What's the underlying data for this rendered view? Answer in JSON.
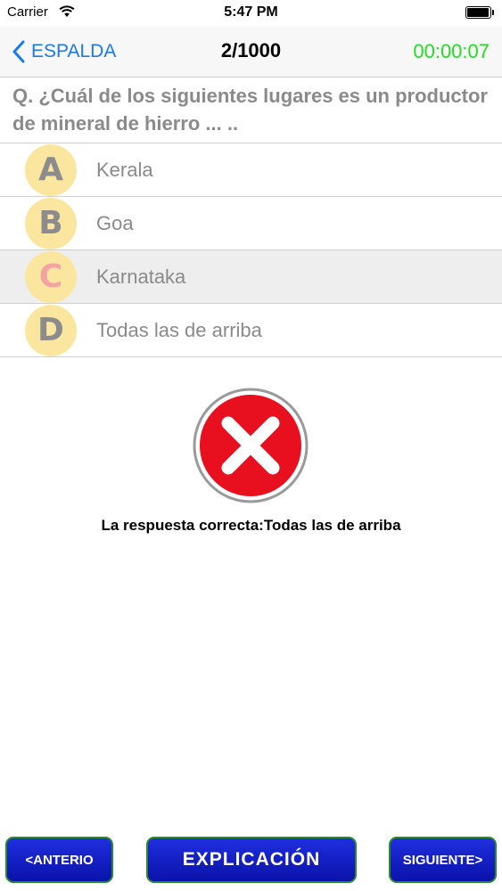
{
  "status_bar": {
    "carrier": "Carrier",
    "time": "5:47 PM",
    "icons": [
      "wifi-icon",
      "battery-icon"
    ]
  },
  "nav": {
    "back_label": "ESPALDA",
    "title": "2/1000",
    "timer": "00:00:07",
    "timer_color": "#22dd22",
    "accent_color": "#1a7ae8"
  },
  "question": {
    "text": "Q. ¿Cuál de los siguientes lugares es un productor de mineral de hierro ... .."
  },
  "options": [
    {
      "letter": "A",
      "text": "Kerala"
    },
    {
      "letter": "B",
      "text": "Goa"
    },
    {
      "letter": "C",
      "text": "Karnataka",
      "selected": true
    },
    {
      "letter": "D",
      "text": "Todas las de arriba"
    }
  ],
  "result": {
    "icon": "wrong-x-icon",
    "correct_answer": "La respuesta correcta:Todas las de arriba"
  },
  "buttons": {
    "previous": "<ANTERIO",
    "explanation": "EXPLICACIÓN",
    "next": "SIGUIENTE>"
  }
}
